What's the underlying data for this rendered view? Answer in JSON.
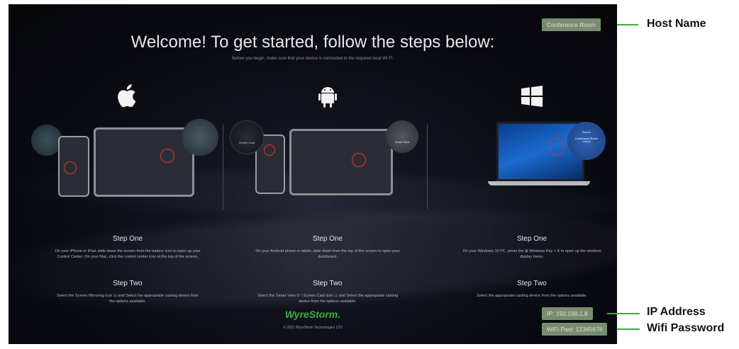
{
  "screen": {
    "title": "Welcome! To get started, follow the steps below:",
    "subtitle": "Before you begin, make sure that your device is connected to the required local Wi-Fi.",
    "host_name_value": "Conference Room",
    "ip_value": "IP: 192.168.1.8",
    "wifi_value": "WiFi Pwd: 12345678",
    "brand": "WyreStorm.",
    "copyright": "© 2021 WyreStorm Technologies LTD"
  },
  "columns": {
    "apple": {
      "step1_title": "Step One",
      "step1_desc": "On your iPhone or iPad, slide down the screen from the battery icon to open up your Control Center. On your Mac, click the control center icon at the top of the screen.",
      "step2_title": "Step Two",
      "step2_desc": "Select the Screen Mirroring icon ▭ and Select the appropriate casting device from the options available."
    },
    "android": {
      "step1_title": "Step One",
      "step1_desc": "On your Android phone or tablet, slide down from the top of the screen to open your dashboard.",
      "step2_title": "Step Two",
      "step2_desc": "Select the Smart View ⟳ / Screen Cast icon ▭ and Select the appropriate casting device from the options available.",
      "bubble_left": "Screen Cast",
      "bubble_right": "Smart View"
    },
    "windows": {
      "step1_title": "Step One",
      "step1_desc": "On your Windows 10 PC, press the ⊞ Windows Key + K to open up the wireless display menu.",
      "step2_title": "Step Two",
      "step2_desc": "Select the appropriate casting device from the options available.",
      "bubble_search": "Search",
      "bubble_device": "Conference Room",
      "bubble_device_sub": "Display"
    }
  },
  "callouts": {
    "host_name": "Host Name",
    "ip_address": "IP Address",
    "wifi_password": "Wifi Password"
  },
  "colors": {
    "callout_green": "#3dac3d",
    "brand_green": "#3cb043",
    "highlight_red": "#e0302a"
  }
}
